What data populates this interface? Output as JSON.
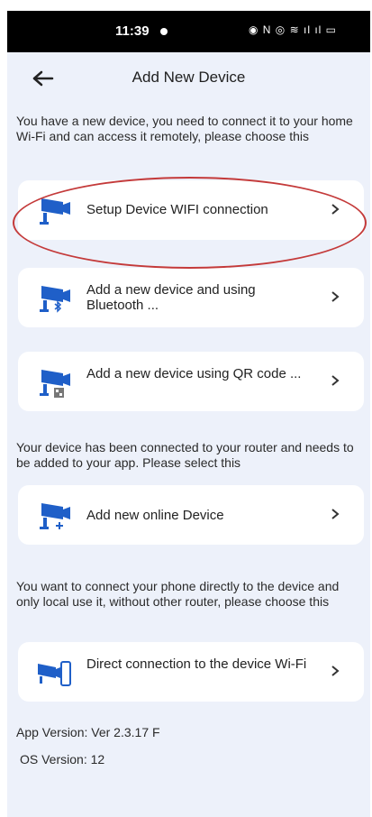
{
  "status": {
    "time": "11:39",
    "icons": "◉ N ◎ ≋ ıl ıl ▭"
  },
  "header": {
    "title": "Add New Device"
  },
  "sections": [
    {
      "text": "You have a new device, you need to connect it to your home Wi-Fi and can access it remotely, please choose this"
    },
    {
      "text": "Your device has been connected to your router and needs to be added to your app. Please select this"
    },
    {
      "text": "You want to connect your phone directly to the device and only local use it, without other router, please choose this"
    }
  ],
  "options": [
    {
      "label": "Setup Device WIFI connection",
      "icon": "camera-wifi-icon"
    },
    {
      "label": "Add a new device and using Bluetooth ...",
      "icon": "camera-bluetooth-icon"
    },
    {
      "label": "Add a new device using QR code ...",
      "icon": "camera-qr-icon"
    },
    {
      "label": "Add new online Device",
      "icon": "camera-add-icon"
    },
    {
      "label": "Direct connection to the device Wi-Fi",
      "icon": "camera-phone-icon"
    }
  ],
  "footer": {
    "app_version": "App Version: Ver 2.3.17 F",
    "os_version": "OS Version: 12"
  },
  "colors": {
    "accent": "#1f6fd6",
    "highlight": "#c43a3a",
    "background": "#edf1fa"
  }
}
